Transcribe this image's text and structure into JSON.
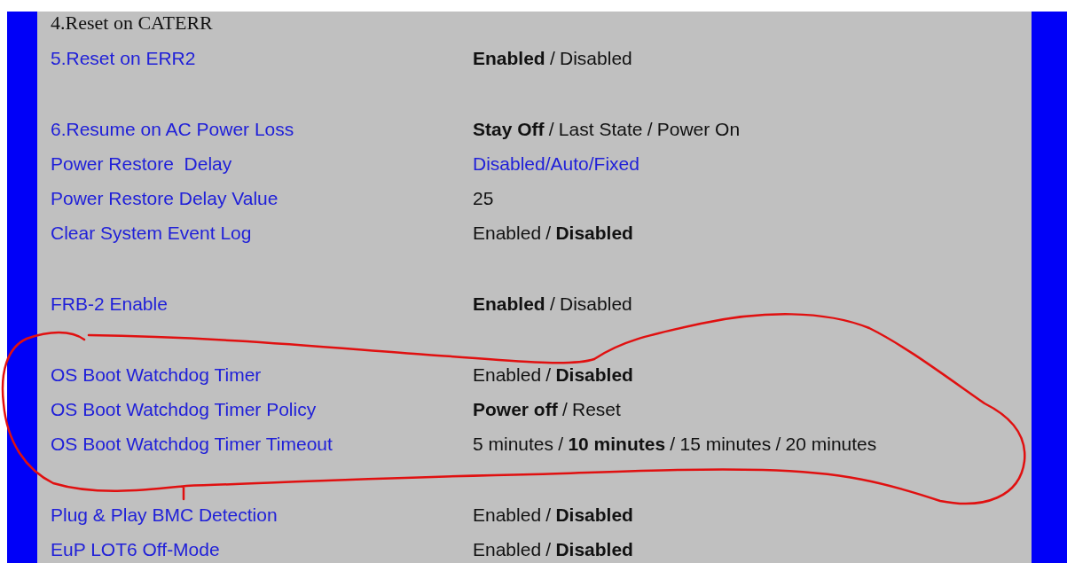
{
  "sections": [
    {
      "rows": [
        {
          "kind": "heading",
          "label": "4.Reset on CATERR"
        },
        {
          "kind": "setting",
          "label": "5.Reset on ERR2",
          "value": {
            "kind": "options",
            "separator": "/",
            "options": [
              {
                "label": "Enabled",
                "selected": true
              },
              {
                "label": "Disabled",
                "selected": false
              }
            ]
          }
        }
      ]
    },
    {
      "rows": [
        {
          "kind": "setting",
          "label": "6.Resume on AC Power Loss",
          "value": {
            "kind": "options",
            "separator": "/",
            "options": [
              {
                "label": "Stay Off",
                "selected": true
              },
              {
                "label": "Last State",
                "selected": false
              },
              {
                "label": "Power On",
                "selected": false
              }
            ]
          }
        },
        {
          "kind": "setting",
          "label": "Power Restore  Delay",
          "value": {
            "kind": "link",
            "text": "Disabled/Auto/Fixed"
          }
        },
        {
          "kind": "setting",
          "label": "Power Restore Delay Value",
          "value": {
            "kind": "text",
            "text": "25"
          }
        },
        {
          "kind": "setting",
          "label": "Clear System Event Log",
          "value": {
            "kind": "options",
            "separator": "/",
            "options": [
              {
                "label": "Enabled",
                "selected": false
              },
              {
                "label": "Disabled",
                "selected": true
              }
            ]
          }
        }
      ]
    },
    {
      "rows": [
        {
          "kind": "setting",
          "label": "FRB-2 Enable",
          "value": {
            "kind": "options",
            "separator": "/",
            "options": [
              {
                "label": "Enabled",
                "selected": true
              },
              {
                "label": "Disabled",
                "selected": false
              }
            ]
          }
        }
      ]
    },
    {
      "rows": [
        {
          "kind": "setting",
          "label": "OS Boot Watchdog Timer",
          "value": {
            "kind": "options",
            "separator": "/",
            "options": [
              {
                "label": "Enabled",
                "selected": false
              },
              {
                "label": "Disabled",
                "selected": true
              }
            ]
          }
        },
        {
          "kind": "setting",
          "label": "OS Boot Watchdog Timer Policy",
          "value": {
            "kind": "options",
            "separator": "/",
            "options": [
              {
                "label": "Power off",
                "selected": true
              },
              {
                "label": "Reset",
                "selected": false
              }
            ]
          }
        },
        {
          "kind": "setting",
          "label": "OS Boot Watchdog Timer Timeout",
          "value": {
            "kind": "options",
            "separator": "/",
            "options": [
              {
                "label": "5 minutes",
                "selected": false
              },
              {
                "label": "10 minutes",
                "selected": true
              },
              {
                "label": "15 minutes",
                "selected": false
              },
              {
                "label": "20 minutes",
                "selected": false
              }
            ]
          }
        }
      ]
    },
    {
      "rows": [
        {
          "kind": "setting",
          "label": "Plug & Play BMC Detection",
          "value": {
            "kind": "options",
            "separator": "/",
            "options": [
              {
                "label": "Enabled",
                "selected": false
              },
              {
                "label": "Disabled",
                "selected": true
              }
            ]
          }
        },
        {
          "kind": "setting",
          "label": "EuP LOT6 Off-Mode",
          "value": {
            "kind": "options",
            "separator": "/",
            "options": [
              {
                "label": "Enabled",
                "selected": false
              },
              {
                "label": "Disabled",
                "selected": true
              }
            ]
          }
        }
      ]
    }
  ]
}
